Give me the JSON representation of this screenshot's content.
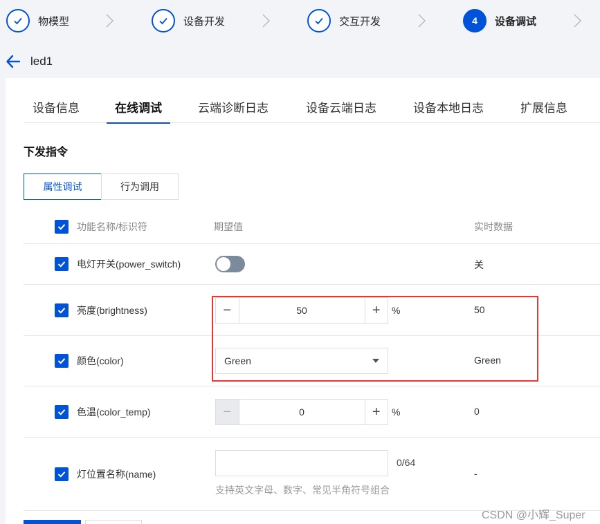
{
  "steps": [
    {
      "label": "物模型",
      "status": "done"
    },
    {
      "label": "设备开发",
      "status": "done"
    },
    {
      "label": "交互开发",
      "status": "done"
    },
    {
      "label": "设备调试",
      "number": "4",
      "status": "active"
    }
  ],
  "header": {
    "device_name": "led1"
  },
  "tabs": [
    "设备信息",
    "在线调试",
    "云端诊断日志",
    "设备云端日志",
    "设备本地日志",
    "扩展信息"
  ],
  "active_tab": "在线调试",
  "section": {
    "title": "下发指令"
  },
  "sub_tabs": [
    "属性调试",
    "行为调用"
  ],
  "table": {
    "headers": {
      "name": "功能名称/标识符",
      "expected": "期望值",
      "realtime": "实时数据"
    },
    "rows": [
      {
        "name": "电灯开关(power_switch)",
        "control": "toggle",
        "toggle_on": false,
        "realtime": "关"
      },
      {
        "name": "亮度(brightness)",
        "control": "stepper",
        "value": "50",
        "unit": "%",
        "realtime": "50"
      },
      {
        "name": "颜色(color)",
        "control": "select",
        "selected": "Green",
        "realtime": "Green"
      },
      {
        "name": "色温(color_temp)",
        "control": "stepper",
        "value": "0",
        "unit": "%",
        "realtime": "0"
      },
      {
        "name": "灯位置名称(name)",
        "control": "text",
        "value": "",
        "counter": "0/64",
        "hint": "支持英文字母、数字、常见半角符号组合",
        "realtime": "-"
      }
    ]
  },
  "watermark": "CSDN @小辉_Super",
  "colors": {
    "accent": "#0052d9",
    "highlight": "#e53935",
    "toggle_off": "#7c8b9c"
  }
}
